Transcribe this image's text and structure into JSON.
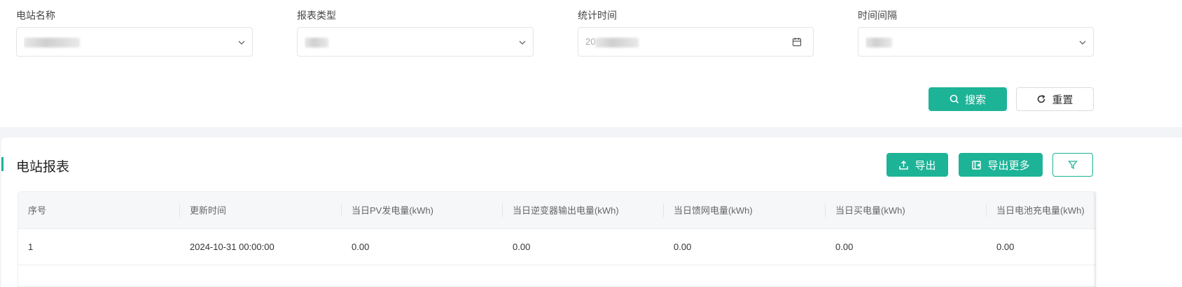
{
  "filters": [
    {
      "label": "电站名称",
      "value": "",
      "type": "select"
    },
    {
      "label": "报表类型",
      "value": "",
      "type": "select"
    },
    {
      "label": "统计时间",
      "value": "20",
      "type": "date"
    },
    {
      "label": "时间间隔",
      "value": "",
      "type": "select"
    }
  ],
  "actions": {
    "search_label": "搜索",
    "reset_label": "重置"
  },
  "report": {
    "title": "电站报表",
    "export_label": "导出",
    "export_more_label": "导出更多"
  },
  "table": {
    "columns": [
      "序号",
      "更新时间",
      "当日PV发电量(kWh)",
      "当日逆变器输出电量(kWh)",
      "当日馈网电量(kWh)",
      "当日买电量(kWh)",
      "当日电池充电量(kWh)"
    ],
    "rows": [
      [
        "1",
        "2024-10-31 00:00:00",
        "0.00",
        "0.00",
        "0.00",
        "0.00",
        "0.00"
      ]
    ]
  },
  "colors": {
    "accent": "#1db397"
  }
}
